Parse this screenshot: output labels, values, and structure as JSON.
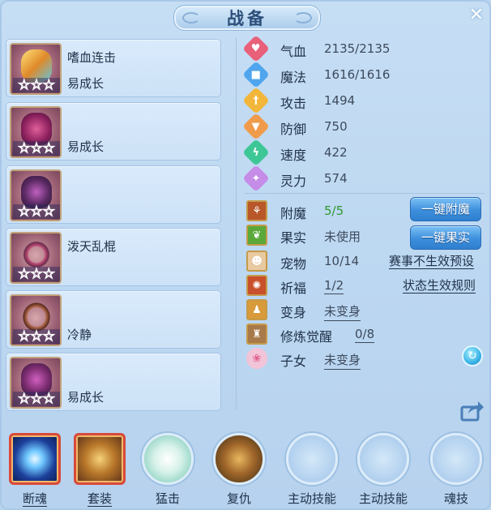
{
  "title": "战备",
  "close_glyph": "✕",
  "equipment": [
    {
      "line1": "嗜血连击",
      "line2": "易成长",
      "stars": [
        "☆",
        "☆",
        "☆"
      ],
      "color": "#e2c23e"
    },
    {
      "line1": "",
      "line2": "易成长",
      "stars": [
        "☆",
        "☆",
        "☆"
      ],
      "color": "#b63a7c"
    },
    {
      "line1": "",
      "line2": "",
      "stars": [
        "☆",
        "☆",
        "☆"
      ],
      "color": "#5a2a63"
    },
    {
      "line1": "泼天乱棍",
      "line2": "",
      "stars": [
        "☆",
        "☆",
        "☆"
      ],
      "color": "#a04f68"
    },
    {
      "line1": "",
      "line2": "冷静",
      "stars": [
        "☆",
        "☆",
        "☆"
      ],
      "color": "#8a4b3e"
    },
    {
      "line1": "",
      "line2": "易成长",
      "stars": [
        "☆",
        "☆",
        "☆"
      ],
      "color": "#7a2b6e"
    }
  ],
  "stats": [
    {
      "label": "气血",
      "value": "2135/2135",
      "icon": "heart-icon",
      "color": "#e8607a",
      "glyph": "♥"
    },
    {
      "label": "魔法",
      "value": "1616/1616",
      "icon": "mana-icon",
      "color": "#4fa6ee",
      "glyph": "■"
    },
    {
      "label": "攻击",
      "value": "1494",
      "icon": "sword-icon",
      "color": "#f2b63a",
      "glyph": "†"
    },
    {
      "label": "防御",
      "value": "750",
      "icon": "shield-icon",
      "color": "#f09b4b",
      "glyph": "▼"
    },
    {
      "label": "速度",
      "value": "422",
      "icon": "speed-icon",
      "color": "#3ec796",
      "glyph": "ϟ"
    },
    {
      "label": "灵力",
      "value": "574",
      "icon": "spirit-icon",
      "color": "#c58ce8",
      "glyph": "✦"
    }
  ],
  "features": {
    "enchant": {
      "label": "附魔",
      "value": "5/5",
      "button": "一键附魔"
    },
    "fruit": {
      "label": "果实",
      "value": "未使用",
      "button": "一键果实"
    },
    "pet": {
      "label": "宠物",
      "value": "10/14",
      "link": "赛事不生效预设"
    },
    "blessing": {
      "label": "祈福",
      "value": "1/2",
      "link": "状态生效规则"
    },
    "transform": {
      "label": "变身",
      "value": "未变身"
    },
    "cultivation": {
      "label": "修炼觉醒",
      "value": "0/8"
    },
    "children": {
      "label": "子女",
      "value": "未变身"
    }
  },
  "skills": [
    {
      "label": "断魂",
      "underline": true
    },
    {
      "label": "套装",
      "underline": true
    },
    {
      "label": "猛击",
      "underline": false
    },
    {
      "label": "复仇",
      "underline": false
    },
    {
      "label": "主动技能",
      "underline": false
    },
    {
      "label": "主动技能",
      "underline": false
    },
    {
      "label": "魂技",
      "underline": false
    }
  ],
  "colors": {
    "panel_bg": "#c6def4",
    "button_blue": "#3d8fdc",
    "enchant_value": "#2f9a2f",
    "text_dark": "#21324a"
  }
}
